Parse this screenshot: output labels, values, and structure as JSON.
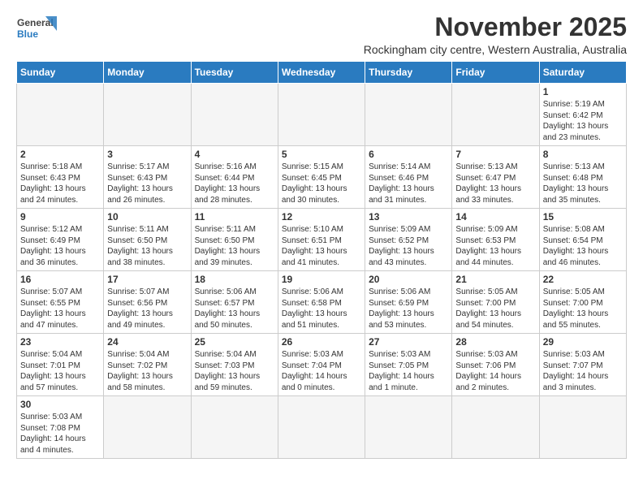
{
  "header": {
    "logo_general": "General",
    "logo_blue": "Blue",
    "month_year": "November 2025",
    "subtitle": "Rockingham city centre, Western Australia, Australia"
  },
  "days_of_week": [
    "Sunday",
    "Monday",
    "Tuesday",
    "Wednesday",
    "Thursday",
    "Friday",
    "Saturday"
  ],
  "weeks": [
    [
      {
        "day": "",
        "content": ""
      },
      {
        "day": "",
        "content": ""
      },
      {
        "day": "",
        "content": ""
      },
      {
        "day": "",
        "content": ""
      },
      {
        "day": "",
        "content": ""
      },
      {
        "day": "",
        "content": ""
      },
      {
        "day": "1",
        "content": "Sunrise: 5:19 AM\nSunset: 6:42 PM\nDaylight: 13 hours\nand 23 minutes."
      }
    ],
    [
      {
        "day": "2",
        "content": "Sunrise: 5:18 AM\nSunset: 6:43 PM\nDaylight: 13 hours\nand 24 minutes."
      },
      {
        "day": "3",
        "content": "Sunrise: 5:17 AM\nSunset: 6:43 PM\nDaylight: 13 hours\nand 26 minutes."
      },
      {
        "day": "4",
        "content": "Sunrise: 5:16 AM\nSunset: 6:44 PM\nDaylight: 13 hours\nand 28 minutes."
      },
      {
        "day": "5",
        "content": "Sunrise: 5:15 AM\nSunset: 6:45 PM\nDaylight: 13 hours\nand 30 minutes."
      },
      {
        "day": "6",
        "content": "Sunrise: 5:14 AM\nSunset: 6:46 PM\nDaylight: 13 hours\nand 31 minutes."
      },
      {
        "day": "7",
        "content": "Sunrise: 5:13 AM\nSunset: 6:47 PM\nDaylight: 13 hours\nand 33 minutes."
      },
      {
        "day": "8",
        "content": "Sunrise: 5:13 AM\nSunset: 6:48 PM\nDaylight: 13 hours\nand 35 minutes."
      }
    ],
    [
      {
        "day": "9",
        "content": "Sunrise: 5:12 AM\nSunset: 6:49 PM\nDaylight: 13 hours\nand 36 minutes."
      },
      {
        "day": "10",
        "content": "Sunrise: 5:11 AM\nSunset: 6:50 PM\nDaylight: 13 hours\nand 38 minutes."
      },
      {
        "day": "11",
        "content": "Sunrise: 5:11 AM\nSunset: 6:50 PM\nDaylight: 13 hours\nand 39 minutes."
      },
      {
        "day": "12",
        "content": "Sunrise: 5:10 AM\nSunset: 6:51 PM\nDaylight: 13 hours\nand 41 minutes."
      },
      {
        "day": "13",
        "content": "Sunrise: 5:09 AM\nSunset: 6:52 PM\nDaylight: 13 hours\nand 43 minutes."
      },
      {
        "day": "14",
        "content": "Sunrise: 5:09 AM\nSunset: 6:53 PM\nDaylight: 13 hours\nand 44 minutes."
      },
      {
        "day": "15",
        "content": "Sunrise: 5:08 AM\nSunset: 6:54 PM\nDaylight: 13 hours\nand 46 minutes."
      }
    ],
    [
      {
        "day": "16",
        "content": "Sunrise: 5:07 AM\nSunset: 6:55 PM\nDaylight: 13 hours\nand 47 minutes."
      },
      {
        "day": "17",
        "content": "Sunrise: 5:07 AM\nSunset: 6:56 PM\nDaylight: 13 hours\nand 49 minutes."
      },
      {
        "day": "18",
        "content": "Sunrise: 5:06 AM\nSunset: 6:57 PM\nDaylight: 13 hours\nand 50 minutes."
      },
      {
        "day": "19",
        "content": "Sunrise: 5:06 AM\nSunset: 6:58 PM\nDaylight: 13 hours\nand 51 minutes."
      },
      {
        "day": "20",
        "content": "Sunrise: 5:06 AM\nSunset: 6:59 PM\nDaylight: 13 hours\nand 53 minutes."
      },
      {
        "day": "21",
        "content": "Sunrise: 5:05 AM\nSunset: 7:00 PM\nDaylight: 13 hours\nand 54 minutes."
      },
      {
        "day": "22",
        "content": "Sunrise: 5:05 AM\nSunset: 7:00 PM\nDaylight: 13 hours\nand 55 minutes."
      }
    ],
    [
      {
        "day": "23",
        "content": "Sunrise: 5:04 AM\nSunset: 7:01 PM\nDaylight: 13 hours\nand 57 minutes."
      },
      {
        "day": "24",
        "content": "Sunrise: 5:04 AM\nSunset: 7:02 PM\nDaylight: 13 hours\nand 58 minutes."
      },
      {
        "day": "25",
        "content": "Sunrise: 5:04 AM\nSunset: 7:03 PM\nDaylight: 13 hours\nand 59 minutes."
      },
      {
        "day": "26",
        "content": "Sunrise: 5:03 AM\nSunset: 7:04 PM\nDaylight: 14 hours\nand 0 minutes."
      },
      {
        "day": "27",
        "content": "Sunrise: 5:03 AM\nSunset: 7:05 PM\nDaylight: 14 hours\nand 1 minute."
      },
      {
        "day": "28",
        "content": "Sunrise: 5:03 AM\nSunset: 7:06 PM\nDaylight: 14 hours\nand 2 minutes."
      },
      {
        "day": "29",
        "content": "Sunrise: 5:03 AM\nSunset: 7:07 PM\nDaylight: 14 hours\nand 3 minutes."
      }
    ],
    [
      {
        "day": "30",
        "content": "Sunrise: 5:03 AM\nSunset: 7:08 PM\nDaylight: 14 hours\nand 4 minutes."
      },
      {
        "day": "",
        "content": ""
      },
      {
        "day": "",
        "content": ""
      },
      {
        "day": "",
        "content": ""
      },
      {
        "day": "",
        "content": ""
      },
      {
        "day": "",
        "content": ""
      },
      {
        "day": "",
        "content": ""
      }
    ]
  ]
}
